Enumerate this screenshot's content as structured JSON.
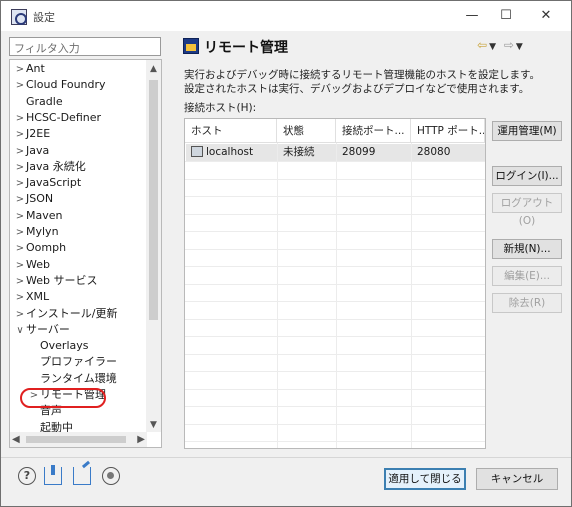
{
  "window": {
    "title": "設定",
    "minimize_glyph": "—",
    "maximize_glyph": "☐",
    "close_glyph": "✕"
  },
  "filter": {
    "placeholder": "フィルタ入力"
  },
  "tree": {
    "items": [
      {
        "label": "Ant",
        "arrow": ">",
        "indent": 0
      },
      {
        "label": "Cloud Foundry",
        "arrow": ">",
        "indent": 0
      },
      {
        "label": "Gradle",
        "arrow": "",
        "indent": 0
      },
      {
        "label": "HCSC-Definer",
        "arrow": ">",
        "indent": 0
      },
      {
        "label": "J2EE",
        "arrow": ">",
        "indent": 0
      },
      {
        "label": "Java",
        "arrow": ">",
        "indent": 0
      },
      {
        "label": "Java 永続化",
        "arrow": ">",
        "indent": 0
      },
      {
        "label": "JavaScript",
        "arrow": ">",
        "indent": 0
      },
      {
        "label": "JSON",
        "arrow": ">",
        "indent": 0
      },
      {
        "label": "Maven",
        "arrow": ">",
        "indent": 0
      },
      {
        "label": "Mylyn",
        "arrow": ">",
        "indent": 0
      },
      {
        "label": "Oomph",
        "arrow": ">",
        "indent": 0
      },
      {
        "label": "Web",
        "arrow": ">",
        "indent": 0
      },
      {
        "label": "Web サービス",
        "arrow": ">",
        "indent": 0
      },
      {
        "label": "XML",
        "arrow": ">",
        "indent": 0
      },
      {
        "label": "インストール/更新",
        "arrow": ">",
        "indent": 0
      },
      {
        "label": "サーバー",
        "arrow": "∨",
        "indent": 0
      },
      {
        "label": "Overlays",
        "arrow": "",
        "indent": 1
      },
      {
        "label": "プロファイラー",
        "arrow": "",
        "indent": 1
      },
      {
        "label": "ランタイム環境",
        "arrow": "",
        "indent": 1
      },
      {
        "label": "リモート管理",
        "arrow": ">",
        "indent": 1
      },
      {
        "label": "音声",
        "arrow": "",
        "indent": 1
      },
      {
        "label": "起動中",
        "arrow": "",
        "indent": 1
      }
    ]
  },
  "page": {
    "title": "リモート管理",
    "description_line1": "実行およびデバッグ時に接続するリモート管理機能のホストを設定します。",
    "description_line2": "設定されたホストは実行、デバッグおよびデプロイなどで使用されます。",
    "hosts_label": "接続ホスト(H):",
    "nav_back": "⇦",
    "nav_fwd": "⇨",
    "nav_drop": "▼"
  },
  "table": {
    "columns": [
      "ホスト",
      "状態",
      "接続ポート...",
      "HTTP ポート..."
    ],
    "rows": [
      {
        "host": "localhost",
        "status": "未接続",
        "port": "28099",
        "http_port": "28080"
      }
    ]
  },
  "buttons": {
    "operation_management": "運用管理(M)",
    "login": "ログイン(I)...",
    "logout": "ログアウト(O)",
    "new": "新規(N)...",
    "edit": "編集(E)...",
    "delete": "除去(R)",
    "apply_close": "適用して閉じる",
    "cancel": "キャンセル"
  }
}
